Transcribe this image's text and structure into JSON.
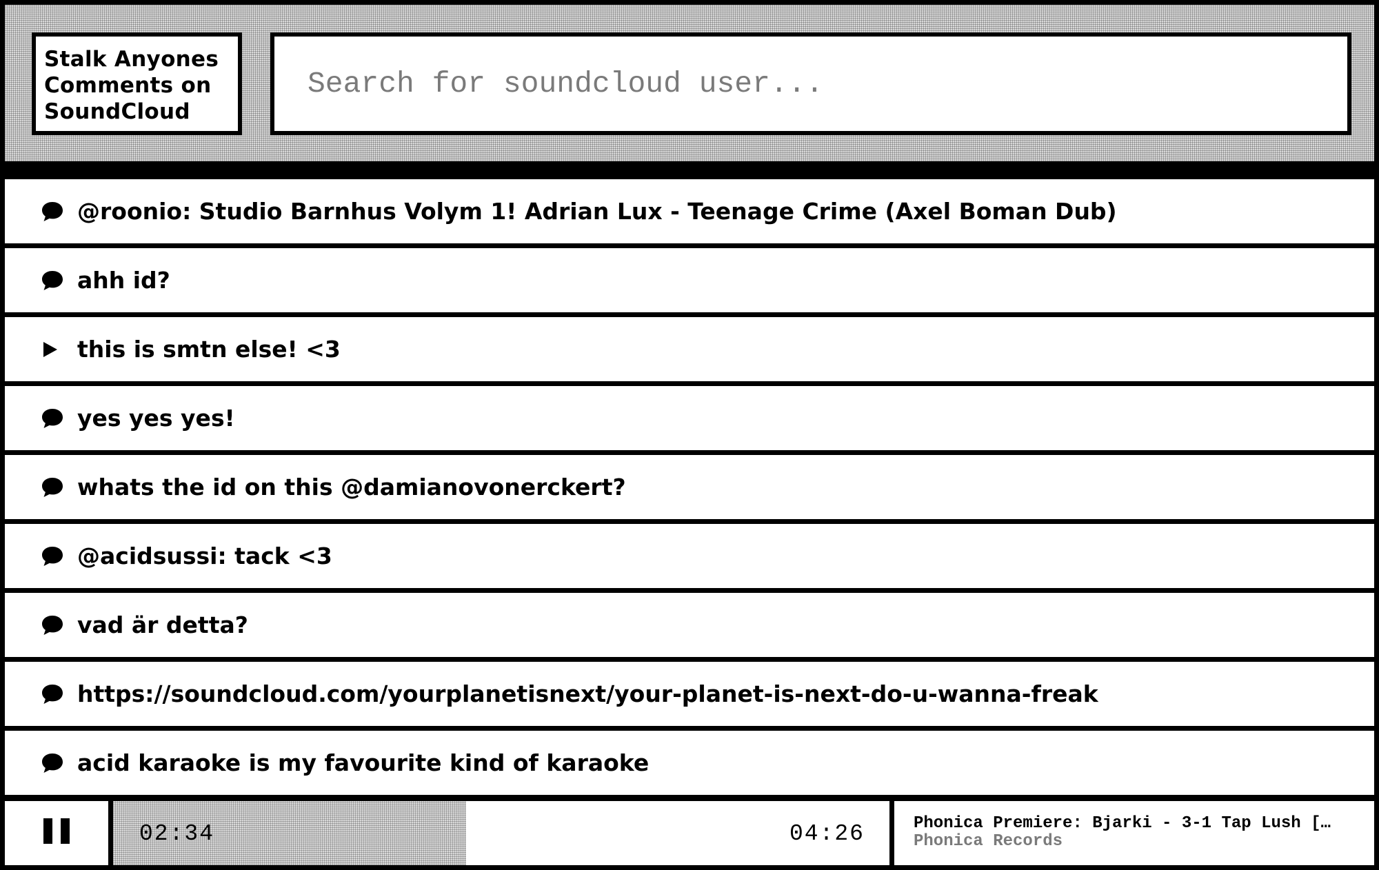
{
  "app": {
    "title_lines": [
      "Stalk Anyones",
      "Comments on",
      "SoundCloud"
    ]
  },
  "search": {
    "placeholder": "Search for soundcloud user...",
    "value": ""
  },
  "comments": [
    {
      "icon": "comment-bubble-icon",
      "text": "@roonio: Studio Barnhus Volym 1! Adrian Lux - Teenage Crime (Axel Boman Dub)"
    },
    {
      "icon": "comment-bubble-icon",
      "text": "ahh id?"
    },
    {
      "icon": "play-triangle-icon",
      "text": "this is smtn else! <3"
    },
    {
      "icon": "comment-bubble-icon",
      "text": "yes yes yes!"
    },
    {
      "icon": "comment-bubble-icon",
      "text": "whats the id on this @damianovonerckert?"
    },
    {
      "icon": "comment-bubble-icon",
      "text": "@acidsussi: tack <3"
    },
    {
      "icon": "comment-bubble-icon",
      "text": "vad är detta?"
    },
    {
      "icon": "comment-bubble-icon",
      "text": "https://soundcloud.com/yourplanetisnext/your-planet-is-next-do-u-wanna-freak"
    },
    {
      "icon": "comment-bubble-icon",
      "text": "acid karaoke is my favourite kind of karaoke"
    }
  ],
  "player": {
    "state_icon": "pause-icon",
    "current_time": "02:34",
    "total_time": "04:26",
    "progress_fraction": 0.455,
    "track_title": "Phonica Premiere: Bjarki - 3-1 Tap Lush […",
    "track_artist": "Phonica Records"
  },
  "colors": {
    "frame": "#000000",
    "panel": "#ffffff",
    "muted_text": "#7a7a7a",
    "dither_base": "#d9d9d9"
  }
}
